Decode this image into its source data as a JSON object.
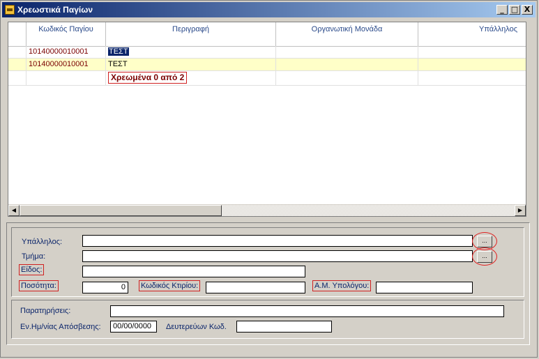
{
  "window": {
    "title": "Χρεωστικά Παγίων",
    "controls": {
      "minimize": "_",
      "maximize": "□",
      "close": "X"
    }
  },
  "grid": {
    "columns": [
      "",
      "Κωδικός Παγίου",
      "Περιγραφή",
      "Οργανωτική Μονάδα",
      "Υπάλληλος"
    ],
    "rows": [
      {
        "code": "10140000010001",
        "description": "ΤΕΣΤ",
        "selected": true
      },
      {
        "code": "10140000010001",
        "description": "ΤΕΣΤ",
        "selected": false
      }
    ],
    "summary": "Χρεωμένα 0 από 2"
  },
  "form": {
    "employee_label": "Υπάλληλος:",
    "department_label": "Τμήμα:",
    "type_label": "Είδος:",
    "quantity_label": "Ποσότητα:",
    "quantity_value": "0",
    "building_code_label": "Κωδικός Κτιρίου:",
    "account_id_label": "Α.Μ. Υπολόγου:",
    "browse_label": "...",
    "notes_label": "Παρατηρήσεις:",
    "depreciation_date_label": "Εν.Ημ/νίας Απόσβεσης:",
    "depreciation_date_value": "00/00/0000",
    "secondary_code_label": "Δευτερεύων Κωδ."
  },
  "colors": {
    "titlebar": "#0a246a",
    "highlight_row": "#ffffc8",
    "annotation": "#d02020"
  }
}
